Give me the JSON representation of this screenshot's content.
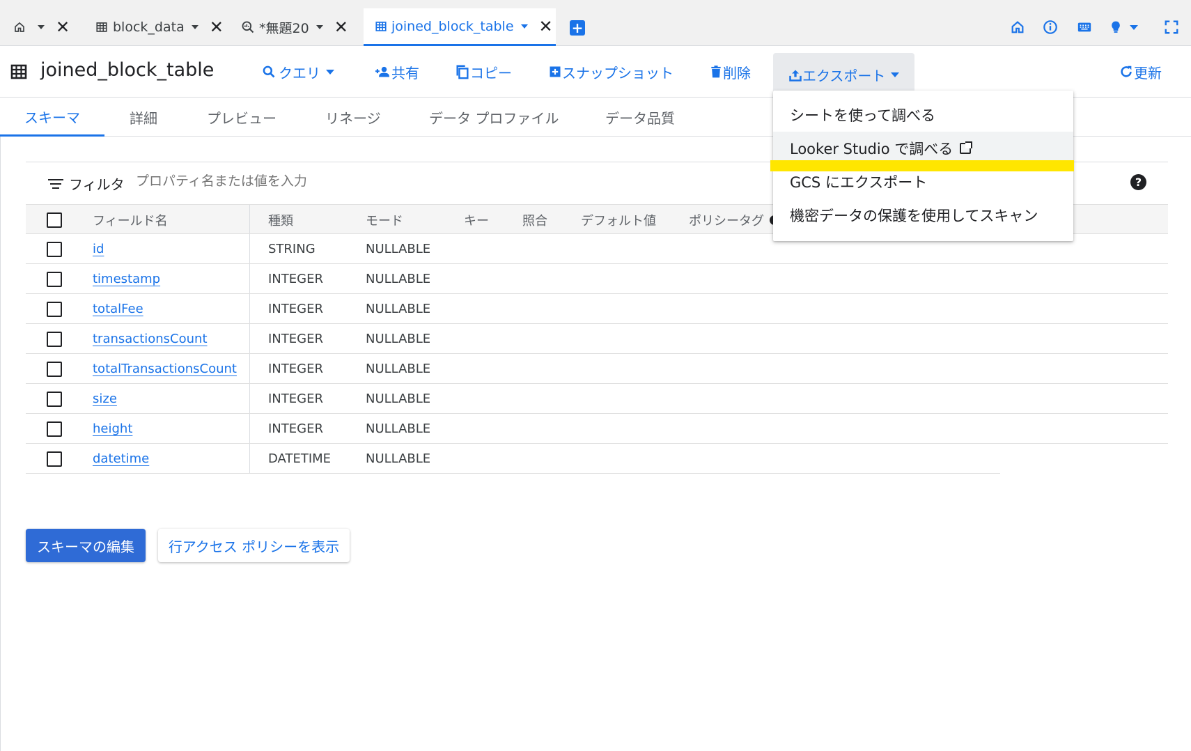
{
  "tabs": [
    {
      "label": "",
      "icon": "home-icon",
      "active": false
    },
    {
      "label": "block_data",
      "icon": "table-icon",
      "active": false
    },
    {
      "label": "*無題20",
      "icon": "query-icon",
      "active": false
    },
    {
      "label": "joined_block_table",
      "icon": "table-icon",
      "active": true
    }
  ],
  "toolbar": {
    "title": "joined_block_table",
    "query": "クエリ",
    "share": "共有",
    "copy": "コピー",
    "snapshot": "スナップショット",
    "delete": "削除",
    "export": "エクスポート",
    "refresh": "更新"
  },
  "subtabs": [
    "スキーマ",
    "詳細",
    "プレビュー",
    "リネージ",
    "データ プロファイル",
    "データ品質"
  ],
  "filter": {
    "label": "フィルタ",
    "placeholder": "プロパティ名または値を入力"
  },
  "schema": {
    "headers": {
      "field_name": "フィールド名",
      "type": "種類",
      "mode": "モード",
      "key": "キー",
      "collation": "照合",
      "default_value": "デフォルト値",
      "policy_tags": "ポリシータグ"
    },
    "rows": [
      {
        "name": "id",
        "type": "STRING",
        "mode": "NULLABLE"
      },
      {
        "name": "timestamp",
        "type": "INTEGER",
        "mode": "NULLABLE"
      },
      {
        "name": "totalFee",
        "type": "INTEGER",
        "mode": "NULLABLE"
      },
      {
        "name": "transactionsCount",
        "type": "INTEGER",
        "mode": "NULLABLE"
      },
      {
        "name": "totalTransactionsCount",
        "type": "INTEGER",
        "mode": "NULLABLE"
      },
      {
        "name": "size",
        "type": "INTEGER",
        "mode": "NULLABLE"
      },
      {
        "name": "height",
        "type": "INTEGER",
        "mode": "NULLABLE"
      },
      {
        "name": "datetime",
        "type": "DATETIME",
        "mode": "NULLABLE"
      }
    ]
  },
  "buttons": {
    "edit_schema": "スキーマの編集",
    "row_access_policy": "行アクセス ポリシーを表示"
  },
  "export_menu": {
    "items": [
      "シートを使って調べる",
      "Looker Studio で調べる",
      "GCS にエクスポート",
      "機密データの保護を使用してスキャン"
    ]
  },
  "colors": {
    "accent": "#1a73e8",
    "primary_button": "#2f6bd6",
    "highlight": "#ffe600"
  }
}
